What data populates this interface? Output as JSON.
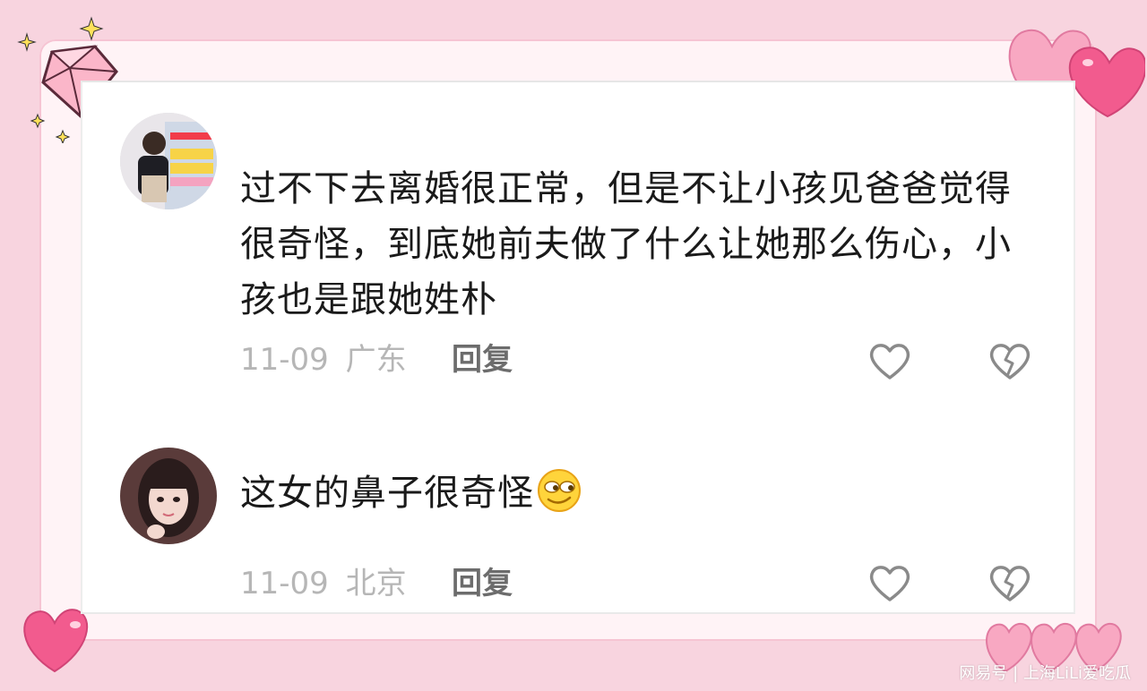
{
  "comments": [
    {
      "avatar": "child-in-store-photo",
      "text": "过不下去离婚很正常，但是不让小孩见爸爸觉得很奇怪，到底她前夫做了什么让她那么伤心，小孩也是跟她姓朴",
      "date": "11-09",
      "location": "广东",
      "reply_label": "回复"
    },
    {
      "avatar": "young-woman-selfie-photo",
      "text": "这女的鼻子很奇怪",
      "emoji": "smirk-face-emoji",
      "date": "11-09",
      "location": "北京",
      "reply_label": "回复"
    }
  ],
  "icons": {
    "like": "heart-outline-icon",
    "dislike": "broken-heart-icon"
  },
  "decorations": [
    "diamond-sticker",
    "sparkle-stars",
    "pink-hearts"
  ],
  "colors": {
    "background": "#f8d4df",
    "heart_pink": "#f472a0",
    "meta_gray": "#b6b6b6"
  },
  "watermark": "网易号 | 上海LiLi爱吃瓜"
}
